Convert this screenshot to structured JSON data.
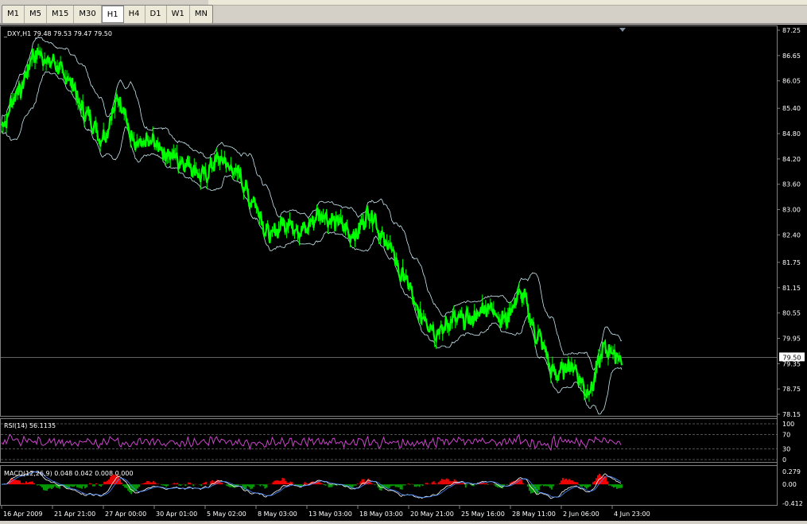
{
  "toolbar": {
    "timeframes": [
      {
        "label": "M1",
        "active": false
      },
      {
        "label": "M5",
        "active": false
      },
      {
        "label": "M15",
        "active": false
      },
      {
        "label": "M30",
        "active": false
      },
      {
        "label": "H1",
        "active": true
      },
      {
        "label": "H4",
        "active": false
      },
      {
        "label": "D1",
        "active": false
      },
      {
        "label": "W1",
        "active": false
      },
      {
        "label": "MN",
        "active": false
      }
    ]
  },
  "main_chart": {
    "symbol_info": "_DXY,H1  79.48 79.53 79.47 79.50",
    "price_scale": [
      "87.25",
      "86.65",
      "86.05",
      "85.40",
      "84.80",
      "84.20",
      "83.60",
      "83.00",
      "82.40",
      "81.75",
      "81.15",
      "80.55",
      "79.95",
      "79.35",
      "78.75",
      "78.15"
    ],
    "current_price": "79.50",
    "colors": {
      "price": "#00ff00",
      "bands": "#c8e8f0",
      "grid": "#808080",
      "text": "#ffffff",
      "background": "#000000"
    }
  },
  "rsi_panel": {
    "label": "RSI(14) 56.1135",
    "scale": [
      "100",
      "70",
      "30",
      "0"
    ],
    "color": "#cc44cc"
  },
  "macd_panel": {
    "label": "MACD(12,26,9) 0.048 0.042 0.008 0.000",
    "scale": [
      "0.279",
      "0.00",
      "-0.412"
    ],
    "colors": {
      "main": "#ffffff",
      "signal": "#4488ff",
      "hist_pos": "#ff0000",
      "hist_neg": "#00a000"
    }
  },
  "time_axis": [
    "16 Apr 2009",
    "21 Apr 21:00",
    "27 Apr 00:00",
    "30 Apr 01:00",
    "5 May 02:00",
    "8 May 03:00",
    "13 May 03:00",
    "18 May 03:00",
    "20 May 21:00",
    "25 May 16:00",
    "28 May 11:00",
    "2 Jun 06:00",
    "4 Jun 23:00"
  ],
  "chart_data": {
    "type": "line",
    "title": "_DXY,H1",
    "ylim": [
      78.15,
      87.25
    ],
    "anchors_x": [
      "16 Apr 2009",
      "21 Apr 21:00",
      "27 Apr 00:00",
      "30 Apr 01:00",
      "5 May 02:00",
      "8 May 03:00",
      "13 May 03:00",
      "18 May 03:00",
      "20 May 21:00",
      "25 May 16:00",
      "28 May 11:00",
      "2 Jun 06:00",
      "4 Jun 23:00"
    ],
    "anchors_y": [
      85.0,
      86.6,
      84.9,
      84.4,
      83.9,
      83.3,
      82.6,
      82.5,
      80.5,
      80.2,
      80.3,
      78.6,
      79.5
    ],
    "series": [
      {
        "values": [
          85.0,
          85.8,
          86.7,
          86.5,
          86.1,
          85.3,
          84.7,
          85.6,
          84.5,
          84.6,
          84.3,
          84.1,
          83.8,
          84.2,
          83.9,
          83.2,
          82.4,
          82.7,
          82.5,
          82.9,
          82.7,
          82.4,
          82.9,
          82.2,
          81.4,
          80.5,
          80.1,
          80.4,
          80.4,
          80.7,
          80.4,
          81.0,
          80.0,
          79.1,
          79.3,
          78.7,
          79.7,
          79.5
        ]
      }
    ],
    "rsi_last": 56.1135,
    "macd": {
      "main": 0.048,
      "signal": 0.042,
      "histogram": 0.008
    }
  }
}
